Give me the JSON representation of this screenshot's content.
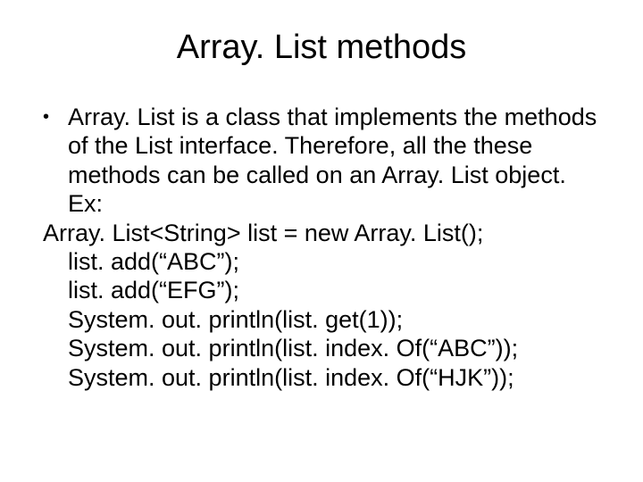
{
  "title": "Array. List methods",
  "bullet": "Array. List is a class that implements the methods of the List interface. Therefore, all the these methods can be called on an Array. List object. Ex:",
  "code": {
    "l1": "Array. List<String> list = new Array. List();",
    "l2": "list. add(“ABC”);",
    "l3": "list. add(“EFG”);",
    "l4": "System. out. println(list. get(1));",
    "l5": "System. out. println(list. index. Of(“ABC”));",
    "l6": "System. out. println(list. index. Of(“HJK”));"
  }
}
